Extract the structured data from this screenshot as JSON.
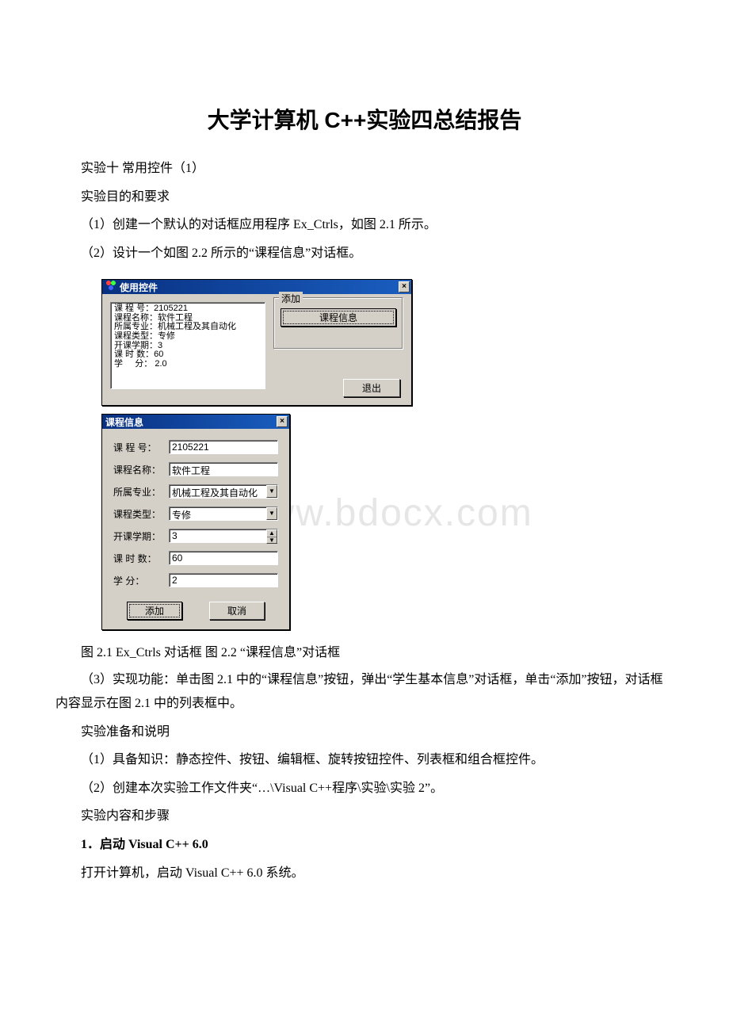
{
  "title": "大学计算机 C++实验四总结报告",
  "lines": {
    "l1": "实验十 常用控件（1）",
    "l2": "实验目的和要求",
    "l3": "（1）创建一个默认的对话框应用程序 Ex_Ctrls，如图 2.1 所示。",
    "l4": "（2）设计一个如图 2.2 所示的“课程信息”对话框。",
    "cap": "图 2.1 Ex_Ctrls 对话框 图 2.2 “课程信息”对话框",
    "l5": "（3）实现功能：单击图 2.1 中的“课程信息”按钮，弹出“学生基本信息”对话框，单击“添加”按钮，对话框内容显示在图 2.1 中的列表框中。",
    "l6": "实验准备和说明",
    "l7": "（1）具备知识：静态控件、按钮、编辑框、旋转按钮控件、列表框和组合框控件。",
    "l8": "（2）创建本次实验工作文件夹“…\\Visual C++程序\\实验\\实验 2”。",
    "l9": "实验内容和步骤",
    "l10": "1．启动 Visual C++ 6.0",
    "l11": "打开计算机，启动 Visual C++ 6.0 系统。"
  },
  "dlg1": {
    "title": "使用控件",
    "close": "×",
    "list": "课 程 号：2105221\n课程名称：软件工程\n所属专业：机械工程及其自动化\n课程类型：专修\n开课学期：3\n课 时 数：60\n学     分： 2.0",
    "group_legend": "添加",
    "btn_course": "课程信息",
    "btn_exit": "退出"
  },
  "dlg2": {
    "title": "课程信息",
    "close": "×",
    "rows": [
      {
        "label": "课 程 号：",
        "value": "2105221",
        "type": "edit"
      },
      {
        "label": "课程名称：",
        "value": "软件工程",
        "type": "edit"
      },
      {
        "label": "所属专业：",
        "value": "机械工程及其自动化",
        "type": "combo"
      },
      {
        "label": "课程类型：",
        "value": "专修",
        "type": "combo"
      },
      {
        "label": "开课学期：",
        "value": "3",
        "type": "spin"
      },
      {
        "label": "课 时 数：",
        "value": "60",
        "type": "edit"
      },
      {
        "label": "学     分：",
        "value": "2",
        "type": "edit"
      }
    ],
    "btn_add": "添加",
    "btn_cancel": "取消"
  },
  "glyphs": {
    "down": "▼",
    "up": "▲"
  },
  "watermark": "www.bdocx.com"
}
